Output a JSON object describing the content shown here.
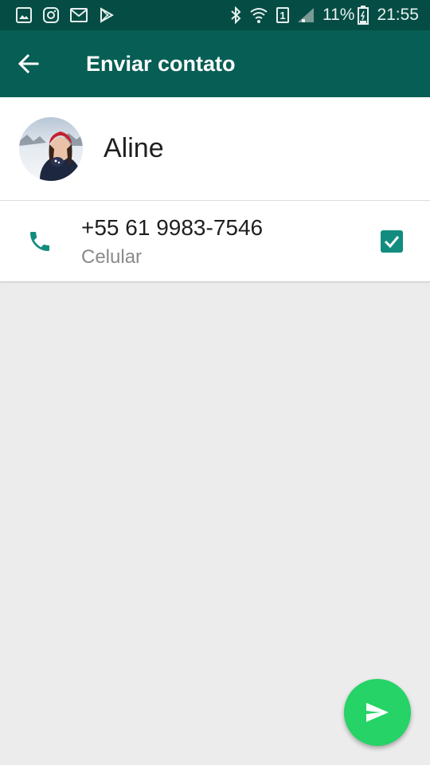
{
  "status_bar": {
    "icons_left": [
      "image-icon",
      "instagram-icon",
      "mail-icon",
      "play-store-icon"
    ],
    "icons_right": [
      "bluetooth-icon",
      "wifi-icon",
      "sim-icon",
      "signal-icon",
      "battery-icon"
    ],
    "sim_label": "1",
    "battery_percent": "11%",
    "time": "21:55"
  },
  "app_bar": {
    "title": "Enviar contato",
    "back_icon": "arrow-back-icon"
  },
  "contact": {
    "name": "Aline"
  },
  "phone_entry": {
    "number": "+55 61 9983-7546",
    "type": "Celular",
    "selected": true
  },
  "fab": {
    "icon": "send-icon"
  },
  "colors": {
    "status_bar": "#054d44",
    "app_bar": "#075e54",
    "accent": "#128c7e",
    "fab": "#25d366",
    "background": "#ececec"
  }
}
